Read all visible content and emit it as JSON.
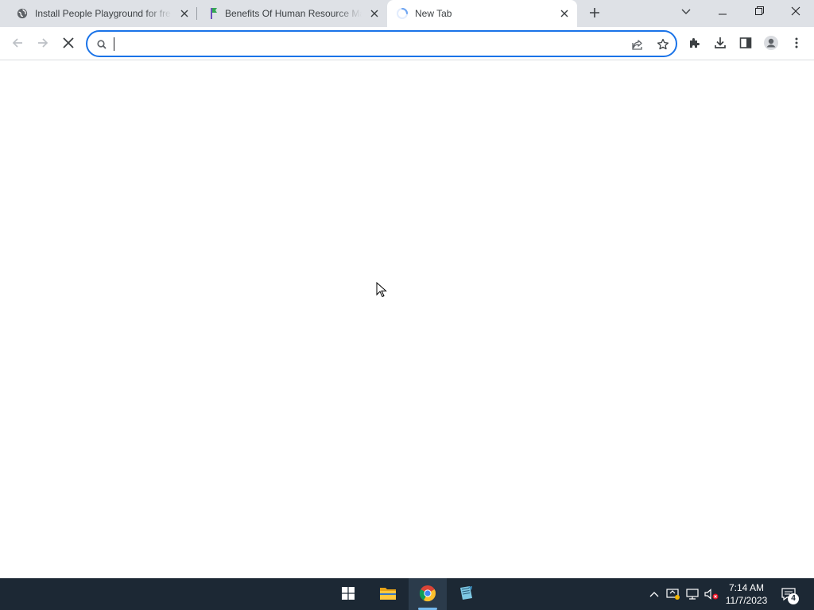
{
  "browser": {
    "tabs": [
      {
        "title": "Install People Playground for fre",
        "favicon": "globe-icon",
        "active": false
      },
      {
        "title": "Benefits Of Human Resource Ma",
        "favicon": "flag-icon",
        "active": false
      },
      {
        "title": "New Tab",
        "favicon": "loading-spinner-icon",
        "active": true
      }
    ],
    "omnibox": {
      "value": "",
      "placeholder": ""
    },
    "toolbar_icons": [
      "back-arrow-icon",
      "forward-arrow-icon",
      "stop-loading-icon",
      "share-icon",
      "bookmark-star-icon",
      "extensions-puzzle-icon",
      "download-icon",
      "side-panel-icon",
      "profile-avatar-icon",
      "menu-kebab-icon"
    ],
    "window_controls": [
      "tab-search-chevron-icon",
      "minimize-icon",
      "restore-icon",
      "close-icon"
    ]
  },
  "taskbar": {
    "apps": [
      "windows-start-icon",
      "file-explorer-icon",
      "chrome-icon",
      "notepad-icon"
    ],
    "tray_icons": [
      "show-hidden-chevron-icon",
      "security-center-icon",
      "network-icon",
      "volume-muted-icon"
    ],
    "clock": {
      "time": "7:14 AM",
      "date": "11/7/2023"
    },
    "notification_count": "4"
  },
  "colors": {
    "tabstrip_bg": "#dee1e6",
    "accent_blue": "#1a73e8",
    "taskbar_bg": "#1c2834"
  }
}
